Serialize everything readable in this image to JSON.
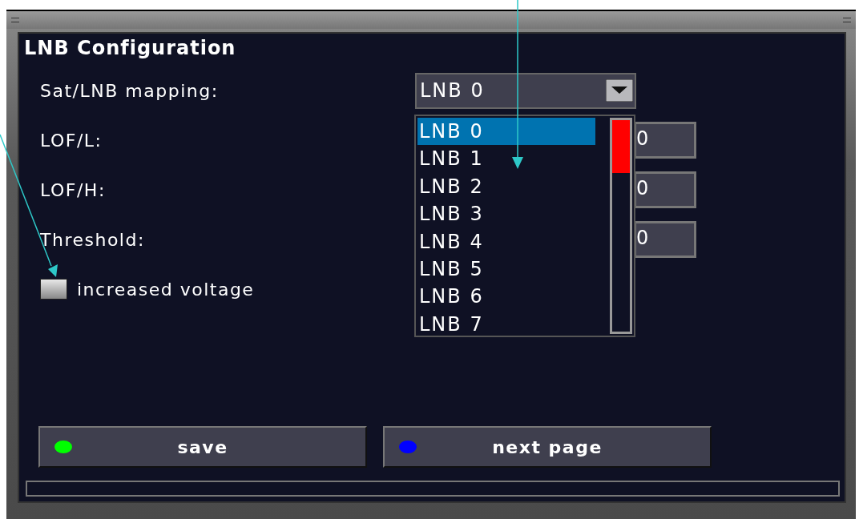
{
  "window": {
    "title": "LNB Configuration"
  },
  "fields": [
    {
      "label": "Sat/LNB mapping:",
      "kind": "dropdown",
      "value": "LNB 0"
    },
    {
      "label": "LOF/L:",
      "kind": "text",
      "value": "0"
    },
    {
      "label": "LOF/H:",
      "kind": "text",
      "value": "0"
    },
    {
      "label": "Threshold:",
      "kind": "text",
      "value": "0"
    }
  ],
  "checkbox": {
    "label": "increased voltage",
    "checked": false
  },
  "dropdown_list": {
    "items": [
      {
        "label": "LNB 0",
        "selected": true
      },
      {
        "label": "LNB 1",
        "selected": false
      },
      {
        "label": "LNB 2",
        "selected": false
      },
      {
        "label": "LNB 3",
        "selected": false
      },
      {
        "label": "LNB 4",
        "selected": false
      },
      {
        "label": "LNB 5",
        "selected": false
      },
      {
        "label": "LNB 6",
        "selected": false
      },
      {
        "label": "LNB 7",
        "selected": false
      }
    ]
  },
  "buttons": [
    {
      "label": "save",
      "color": "#00ff00"
    },
    {
      "label": "next page",
      "color": "#0000ff"
    }
  ]
}
